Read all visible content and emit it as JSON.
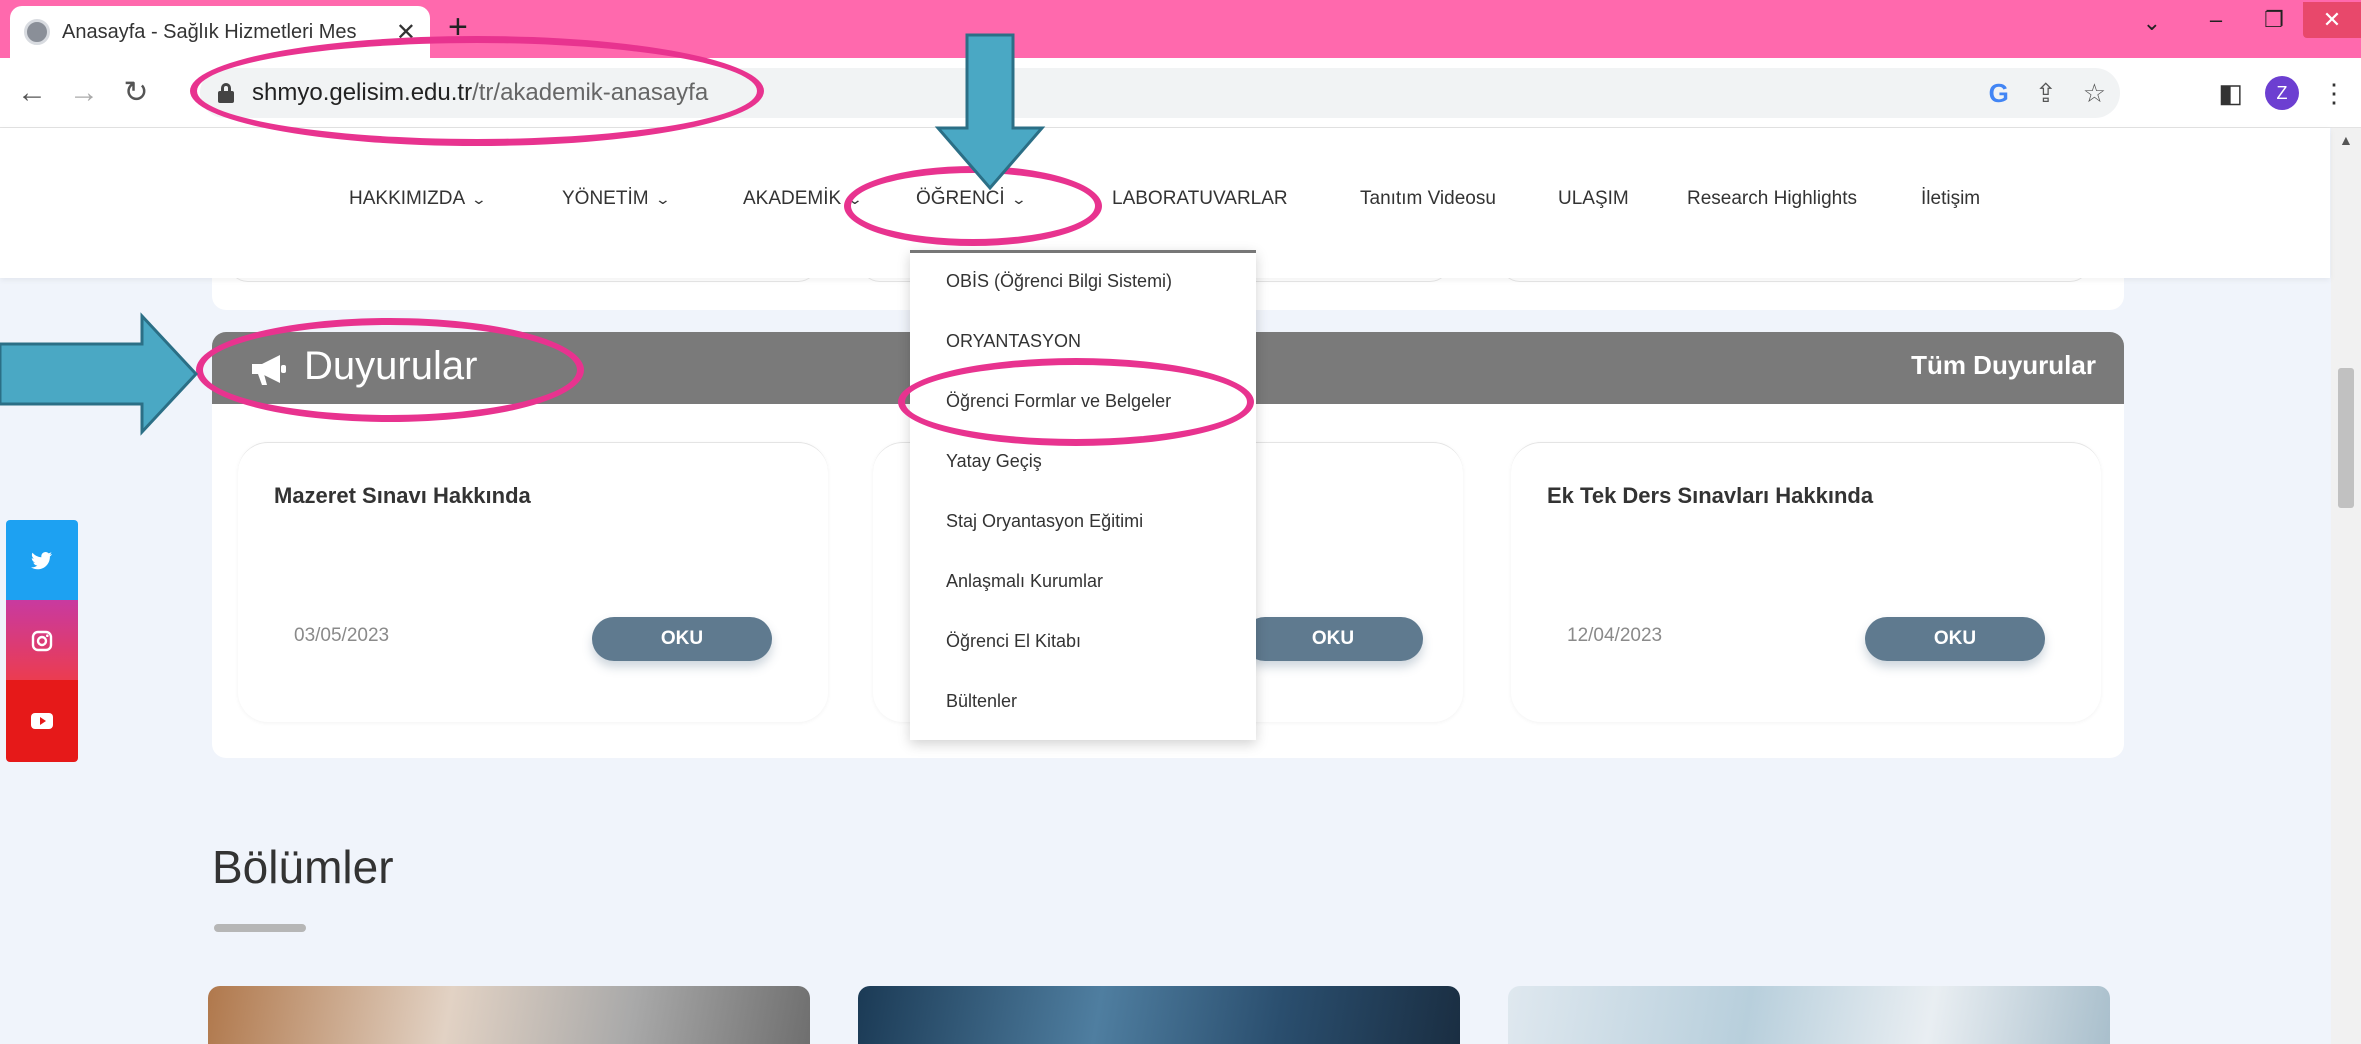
{
  "browser": {
    "tab_title": "Anasayfa - Sağlık Hizmetleri Mes",
    "tab_close": "✕",
    "new_tab": "+",
    "url_host": "shmyo.gelisim.edu.tr",
    "url_path": "/tr/akademik-anasayfa",
    "profile_initial": "Z",
    "tabbar_color": "#ff69ad"
  },
  "nav": {
    "items": [
      {
        "label": "HAKKIMIZDA",
        "dropdown": true
      },
      {
        "label": "YÖNETİM",
        "dropdown": true
      },
      {
        "label": "AKADEMİK",
        "dropdown": true
      },
      {
        "label": "ÖĞRENCİ",
        "dropdown": true
      },
      {
        "label": "LABORATUVARLAR",
        "dropdown": false
      },
      {
        "label": "Tanıtım Videosu",
        "dropdown": false
      },
      {
        "label": "ULAŞIM",
        "dropdown": false
      },
      {
        "label": "Research Highlights",
        "dropdown": false
      },
      {
        "label": "İletişim",
        "dropdown": false
      }
    ]
  },
  "dropdown": {
    "items": [
      "OBİS (Öğrenci Bilgi Sistemi)",
      "ORYANTASYON",
      "Öğrenci Formlar ve Belgeler",
      "Yatay Geçiş",
      "Staj Oryantasyon Eğitimi",
      "Anlaşmalı Kurumlar",
      "Öğrenci El Kitabı",
      "Bültenler"
    ]
  },
  "announcements": {
    "title": "Duyurular",
    "all_link": "Tüm Duyurular",
    "cards": [
      {
        "title": "Mazeret Sınavı Hakkında",
        "date": "03/05/2023",
        "button": "OKU"
      },
      {
        "title": "",
        "date": "",
        "button": "OKU"
      },
      {
        "title": "Ek Tek Ders Sınavları Hakkında",
        "date": "12/04/2023",
        "button": "OKU"
      }
    ]
  },
  "departments": {
    "title": "Bölümler"
  },
  "colors": {
    "annotation": "#e8338f",
    "arrow": "#4aa8c4",
    "announcement_header": "#7a7a7a",
    "oku_button": "#5f7a8f"
  }
}
